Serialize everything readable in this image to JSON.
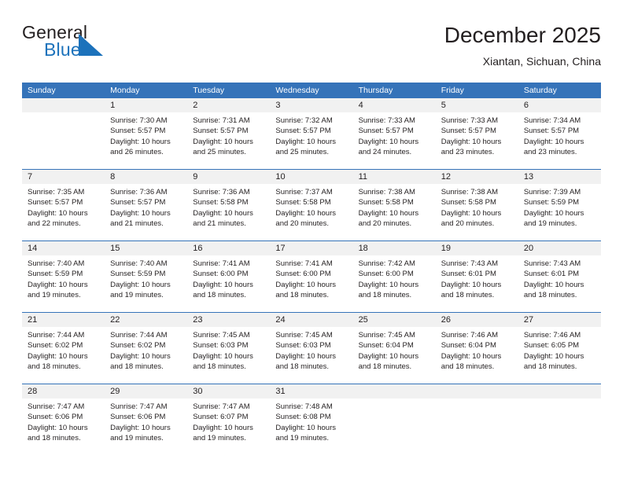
{
  "brand": {
    "word_one": "General",
    "word_two": "Blue",
    "flag_icon": "triangle-flag-icon",
    "accent_color": "#1c72bb"
  },
  "header": {
    "title": "December 2025",
    "subtitle": "Xiantan, Sichuan, China"
  },
  "calendar": {
    "header_bg": "#3573b9",
    "daynum_bg": "#f1f1f1",
    "weekday_headers": [
      "Sunday",
      "Monday",
      "Tuesday",
      "Wednesday",
      "Thursday",
      "Friday",
      "Saturday"
    ],
    "weeks": [
      [
        {
          "day": "",
          "blank": true
        },
        {
          "day": "1",
          "sunrise": "Sunrise: 7:30 AM",
          "sunset": "Sunset: 5:57 PM",
          "daylight_1": "Daylight: 10 hours",
          "daylight_2": "and 26 minutes."
        },
        {
          "day": "2",
          "sunrise": "Sunrise: 7:31 AM",
          "sunset": "Sunset: 5:57 PM",
          "daylight_1": "Daylight: 10 hours",
          "daylight_2": "and 25 minutes."
        },
        {
          "day": "3",
          "sunrise": "Sunrise: 7:32 AM",
          "sunset": "Sunset: 5:57 PM",
          "daylight_1": "Daylight: 10 hours",
          "daylight_2": "and 25 minutes."
        },
        {
          "day": "4",
          "sunrise": "Sunrise: 7:33 AM",
          "sunset": "Sunset: 5:57 PM",
          "daylight_1": "Daylight: 10 hours",
          "daylight_2": "and 24 minutes."
        },
        {
          "day": "5",
          "sunrise": "Sunrise: 7:33 AM",
          "sunset": "Sunset: 5:57 PM",
          "daylight_1": "Daylight: 10 hours",
          "daylight_2": "and 23 minutes."
        },
        {
          "day": "6",
          "sunrise": "Sunrise: 7:34 AM",
          "sunset": "Sunset: 5:57 PM",
          "daylight_1": "Daylight: 10 hours",
          "daylight_2": "and 23 minutes."
        }
      ],
      [
        {
          "day": "7",
          "sunrise": "Sunrise: 7:35 AM",
          "sunset": "Sunset: 5:57 PM",
          "daylight_1": "Daylight: 10 hours",
          "daylight_2": "and 22 minutes."
        },
        {
          "day": "8",
          "sunrise": "Sunrise: 7:36 AM",
          "sunset": "Sunset: 5:57 PM",
          "daylight_1": "Daylight: 10 hours",
          "daylight_2": "and 21 minutes."
        },
        {
          "day": "9",
          "sunrise": "Sunrise: 7:36 AM",
          "sunset": "Sunset: 5:58 PM",
          "daylight_1": "Daylight: 10 hours",
          "daylight_2": "and 21 minutes."
        },
        {
          "day": "10",
          "sunrise": "Sunrise: 7:37 AM",
          "sunset": "Sunset: 5:58 PM",
          "daylight_1": "Daylight: 10 hours",
          "daylight_2": "and 20 minutes."
        },
        {
          "day": "11",
          "sunrise": "Sunrise: 7:38 AM",
          "sunset": "Sunset: 5:58 PM",
          "daylight_1": "Daylight: 10 hours",
          "daylight_2": "and 20 minutes."
        },
        {
          "day": "12",
          "sunrise": "Sunrise: 7:38 AM",
          "sunset": "Sunset: 5:58 PM",
          "daylight_1": "Daylight: 10 hours",
          "daylight_2": "and 20 minutes."
        },
        {
          "day": "13",
          "sunrise": "Sunrise: 7:39 AM",
          "sunset": "Sunset: 5:59 PM",
          "daylight_1": "Daylight: 10 hours",
          "daylight_2": "and 19 minutes."
        }
      ],
      [
        {
          "day": "14",
          "sunrise": "Sunrise: 7:40 AM",
          "sunset": "Sunset: 5:59 PM",
          "daylight_1": "Daylight: 10 hours",
          "daylight_2": "and 19 minutes."
        },
        {
          "day": "15",
          "sunrise": "Sunrise: 7:40 AM",
          "sunset": "Sunset: 5:59 PM",
          "daylight_1": "Daylight: 10 hours",
          "daylight_2": "and 19 minutes."
        },
        {
          "day": "16",
          "sunrise": "Sunrise: 7:41 AM",
          "sunset": "Sunset: 6:00 PM",
          "daylight_1": "Daylight: 10 hours",
          "daylight_2": "and 18 minutes."
        },
        {
          "day": "17",
          "sunrise": "Sunrise: 7:41 AM",
          "sunset": "Sunset: 6:00 PM",
          "daylight_1": "Daylight: 10 hours",
          "daylight_2": "and 18 minutes."
        },
        {
          "day": "18",
          "sunrise": "Sunrise: 7:42 AM",
          "sunset": "Sunset: 6:00 PM",
          "daylight_1": "Daylight: 10 hours",
          "daylight_2": "and 18 minutes."
        },
        {
          "day": "19",
          "sunrise": "Sunrise: 7:43 AM",
          "sunset": "Sunset: 6:01 PM",
          "daylight_1": "Daylight: 10 hours",
          "daylight_2": "and 18 minutes."
        },
        {
          "day": "20",
          "sunrise": "Sunrise: 7:43 AM",
          "sunset": "Sunset: 6:01 PM",
          "daylight_1": "Daylight: 10 hours",
          "daylight_2": "and 18 minutes."
        }
      ],
      [
        {
          "day": "21",
          "sunrise": "Sunrise: 7:44 AM",
          "sunset": "Sunset: 6:02 PM",
          "daylight_1": "Daylight: 10 hours",
          "daylight_2": "and 18 minutes."
        },
        {
          "day": "22",
          "sunrise": "Sunrise: 7:44 AM",
          "sunset": "Sunset: 6:02 PM",
          "daylight_1": "Daylight: 10 hours",
          "daylight_2": "and 18 minutes."
        },
        {
          "day": "23",
          "sunrise": "Sunrise: 7:45 AM",
          "sunset": "Sunset: 6:03 PM",
          "daylight_1": "Daylight: 10 hours",
          "daylight_2": "and 18 minutes."
        },
        {
          "day": "24",
          "sunrise": "Sunrise: 7:45 AM",
          "sunset": "Sunset: 6:03 PM",
          "daylight_1": "Daylight: 10 hours",
          "daylight_2": "and 18 minutes."
        },
        {
          "day": "25",
          "sunrise": "Sunrise: 7:45 AM",
          "sunset": "Sunset: 6:04 PM",
          "daylight_1": "Daylight: 10 hours",
          "daylight_2": "and 18 minutes."
        },
        {
          "day": "26",
          "sunrise": "Sunrise: 7:46 AM",
          "sunset": "Sunset: 6:04 PM",
          "daylight_1": "Daylight: 10 hours",
          "daylight_2": "and 18 minutes."
        },
        {
          "day": "27",
          "sunrise": "Sunrise: 7:46 AM",
          "sunset": "Sunset: 6:05 PM",
          "daylight_1": "Daylight: 10 hours",
          "daylight_2": "and 18 minutes."
        }
      ],
      [
        {
          "day": "28",
          "sunrise": "Sunrise: 7:47 AM",
          "sunset": "Sunset: 6:06 PM",
          "daylight_1": "Daylight: 10 hours",
          "daylight_2": "and 18 minutes."
        },
        {
          "day": "29",
          "sunrise": "Sunrise: 7:47 AM",
          "sunset": "Sunset: 6:06 PM",
          "daylight_1": "Daylight: 10 hours",
          "daylight_2": "and 19 minutes."
        },
        {
          "day": "30",
          "sunrise": "Sunrise: 7:47 AM",
          "sunset": "Sunset: 6:07 PM",
          "daylight_1": "Daylight: 10 hours",
          "daylight_2": "and 19 minutes."
        },
        {
          "day": "31",
          "sunrise": "Sunrise: 7:48 AM",
          "sunset": "Sunset: 6:08 PM",
          "daylight_1": "Daylight: 10 hours",
          "daylight_2": "and 19 minutes."
        },
        {
          "day": "",
          "blank": true
        },
        {
          "day": "",
          "blank": true
        },
        {
          "day": "",
          "blank": true
        }
      ]
    ]
  }
}
